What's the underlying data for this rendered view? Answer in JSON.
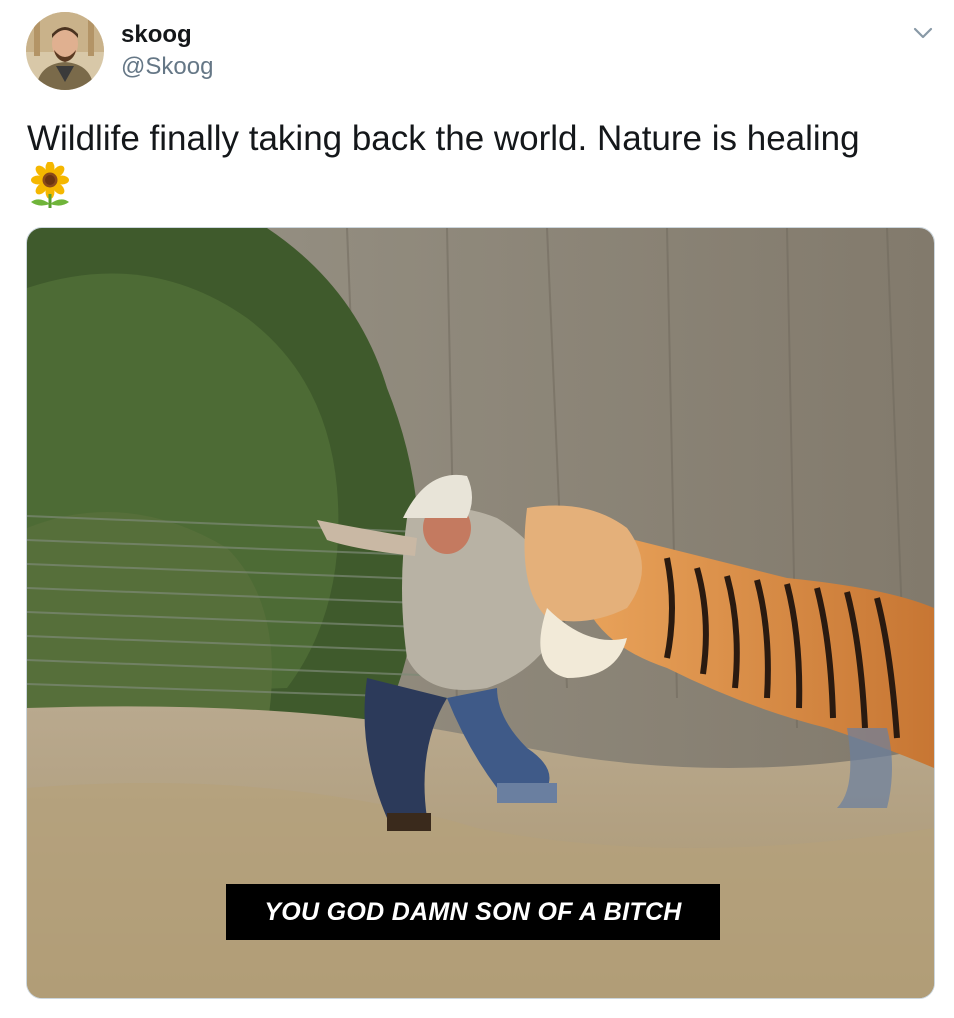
{
  "tweet": {
    "author": {
      "display_name": "skoog",
      "handle": "@Skoog",
      "avatar_icon": "user-avatar-photo"
    },
    "menu_icon": "chevron-down-icon",
    "text": "Wildlife finally taking back the world. Nature is healing",
    "emoji": "sunflower",
    "media": {
      "type": "video-still",
      "caption": "YOU GOD DAMN SON OF A BITCH"
    }
  },
  "colors": {
    "text_primary": "#14171a",
    "text_secondary": "#657786",
    "border": "#ccd6dd"
  }
}
